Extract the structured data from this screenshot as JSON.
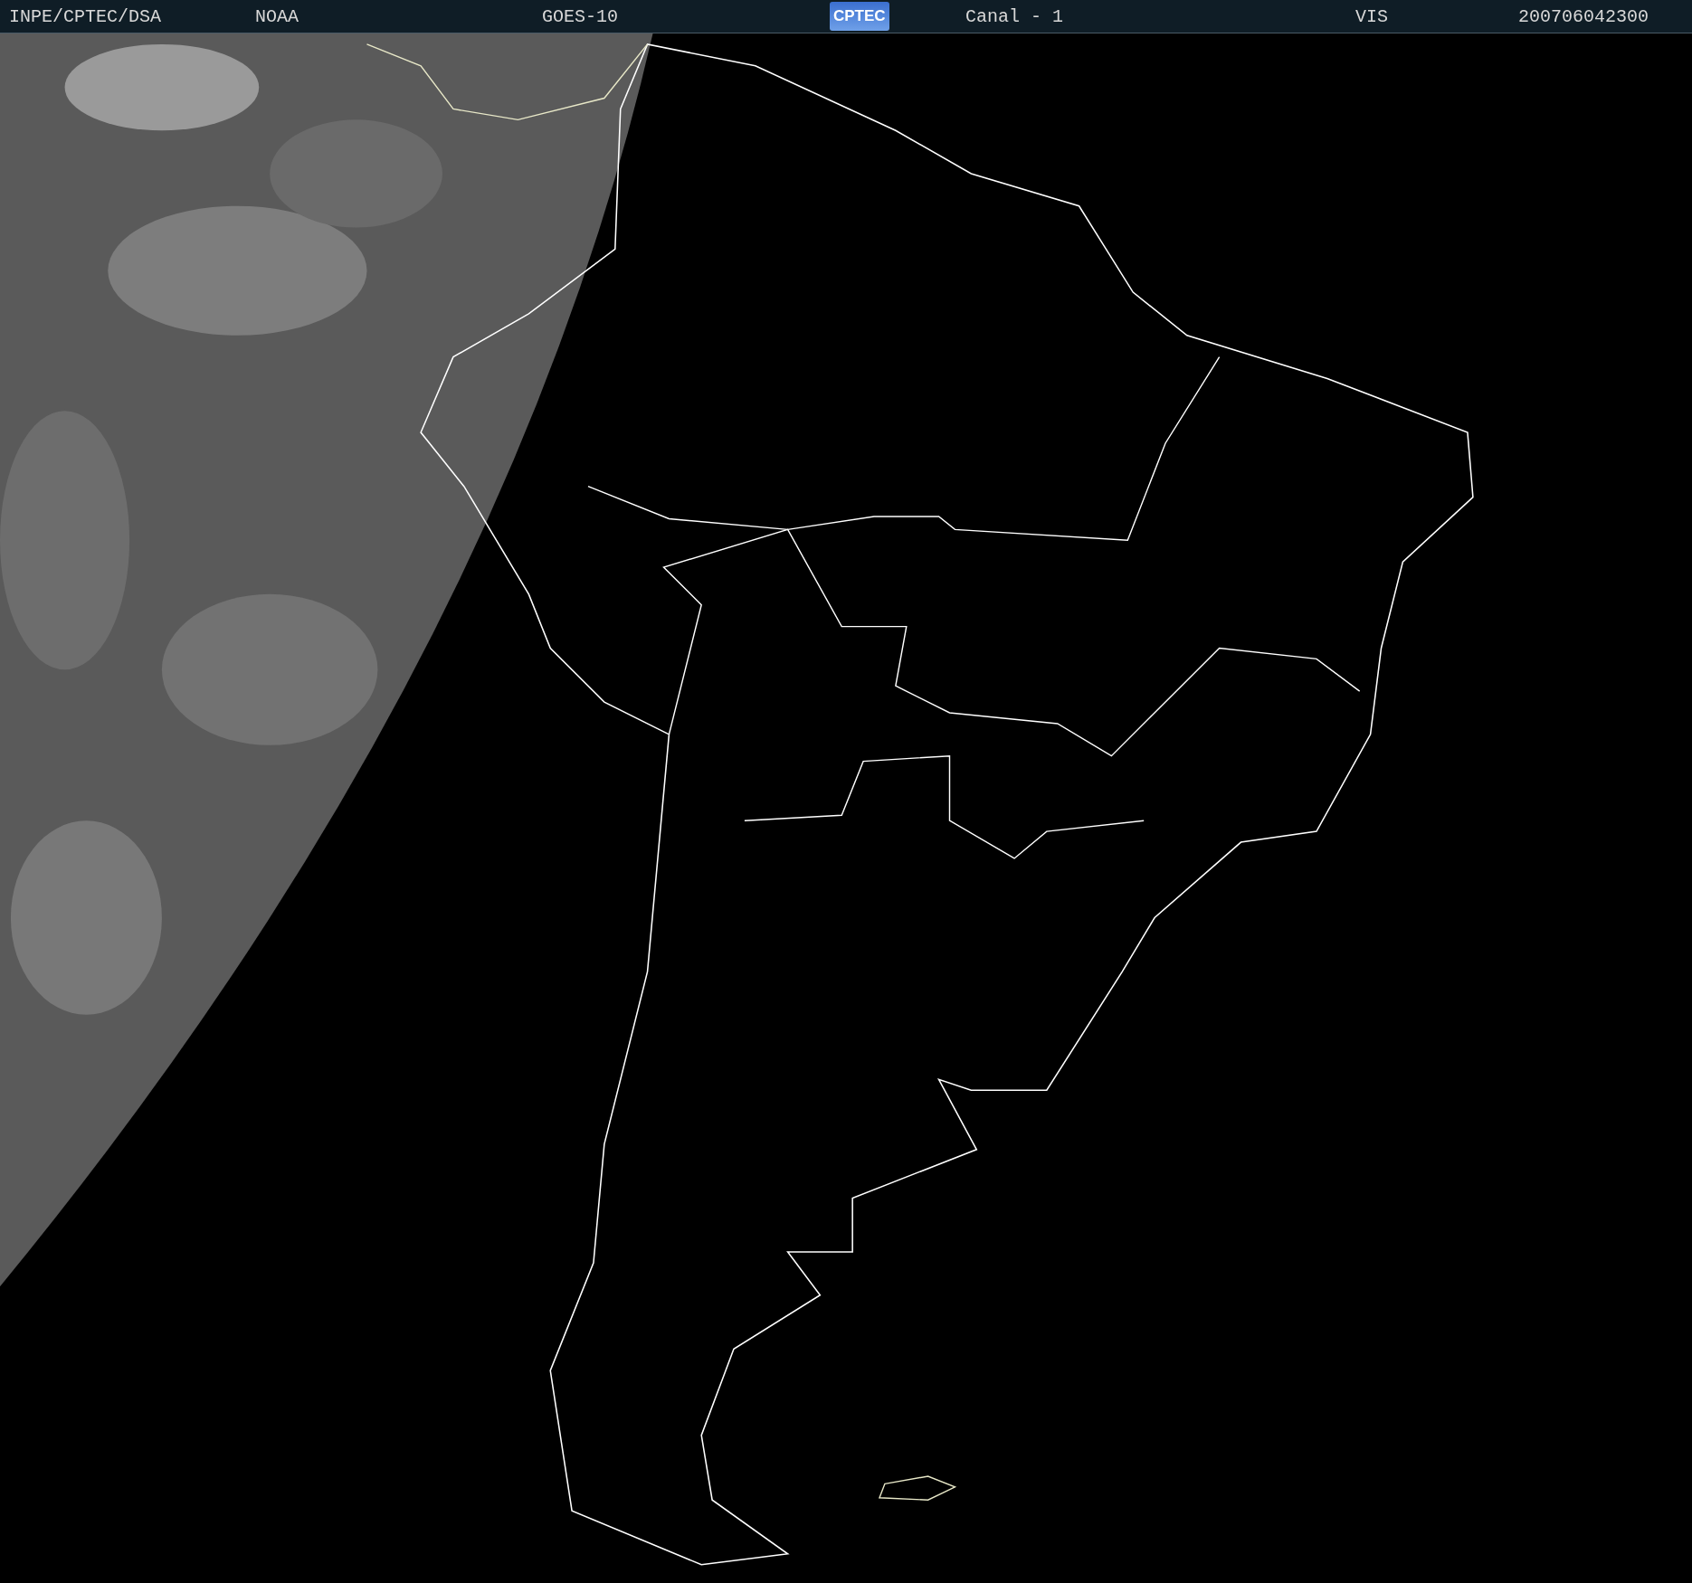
{
  "header": {
    "items": [
      {
        "kind": "text",
        "text": "INPE/CPTEC/DSA"
      },
      {
        "kind": "text",
        "text": "NOAA"
      },
      {
        "kind": "text",
        "text": "GOES-10"
      },
      {
        "kind": "logo",
        "text": "CPTEC"
      },
      {
        "kind": "text",
        "text": "Canal - 1"
      },
      {
        "kind": "text",
        "text": "VIS"
      },
      {
        "kind": "text",
        "text": "200706042300"
      }
    ]
  }
}
